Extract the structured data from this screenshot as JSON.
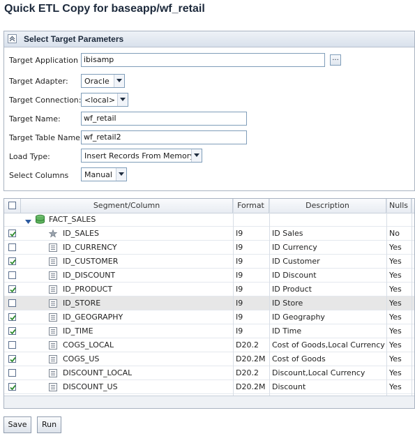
{
  "page": {
    "title": "Quick ETL Copy for baseapp/wf_retail"
  },
  "target_panel": {
    "title": "Select Target Parameters",
    "fields": {
      "target_application": {
        "label": "Target Application",
        "value": "ibisamp",
        "browse_label": "..."
      },
      "target_adapter": {
        "label": "Target Adapter:",
        "value": "Oracle"
      },
      "target_connection": {
        "label": "Target Connection:",
        "value": "<local>"
      },
      "target_name": {
        "label": "Target Name:",
        "value": "wf_retail"
      },
      "target_table_name": {
        "label": "Target Table Name:",
        "value": "wf_retail2"
      },
      "load_type": {
        "label": "Load Type:",
        "value": "Insert Records From Memory"
      },
      "select_columns": {
        "label": "Select Columns",
        "value": "Manual"
      }
    }
  },
  "grid": {
    "headers": {
      "segment_column": "Segment/Column",
      "format": "Format",
      "description": "Description",
      "nulls": "Nulls"
    },
    "segment": {
      "name": "FACT_SALES",
      "expanded": true
    },
    "rows": [
      {
        "name": "ID_SALES",
        "format": "I9",
        "description": "ID Sales",
        "nulls": "No",
        "checked": true,
        "icon": "key-column-icon"
      },
      {
        "name": "ID_CURRENCY",
        "format": "I9",
        "description": "ID Currency",
        "nulls": "Yes",
        "checked": false,
        "icon": "column-icon"
      },
      {
        "name": "ID_CUSTOMER",
        "format": "I9",
        "description": "ID Customer",
        "nulls": "Yes",
        "checked": true,
        "icon": "column-icon"
      },
      {
        "name": "ID_DISCOUNT",
        "format": "I9",
        "description": "ID Discount",
        "nulls": "Yes",
        "checked": false,
        "icon": "column-icon"
      },
      {
        "name": "ID_PRODUCT",
        "format": "I9",
        "description": "ID Product",
        "nulls": "Yes",
        "checked": true,
        "icon": "column-icon"
      },
      {
        "name": "ID_STORE",
        "format": "I9",
        "description": "ID Store",
        "nulls": "Yes",
        "checked": false,
        "icon": "column-icon",
        "highlighted": true
      },
      {
        "name": "ID_GEOGRAPHY",
        "format": "I9",
        "description": "ID Geography",
        "nulls": "Yes",
        "checked": true,
        "icon": "column-icon"
      },
      {
        "name": "ID_TIME",
        "format": "I9",
        "description": "ID Time",
        "nulls": "Yes",
        "checked": true,
        "icon": "column-icon"
      },
      {
        "name": "COGS_LOCAL",
        "format": "D20.2",
        "description": "Cost of Goods,Local Currency",
        "nulls": "Yes",
        "checked": false,
        "icon": "column-icon"
      },
      {
        "name": "COGS_US",
        "format": "D20.2M",
        "description": "Cost of Goods",
        "nulls": "Yes",
        "checked": true,
        "icon": "column-icon"
      },
      {
        "name": "DISCOUNT_LOCAL",
        "format": "D20.2",
        "description": "Discount,Local Currency",
        "nulls": "Yes",
        "checked": false,
        "icon": "column-icon"
      },
      {
        "name": "DISCOUNT_US",
        "format": "D20.2M",
        "description": "Discount",
        "nulls": "Yes",
        "checked": true,
        "icon": "column-icon"
      }
    ]
  },
  "buttons": {
    "save": "Save",
    "run": "Run"
  },
  "colors": {
    "check": "#2e8b2e",
    "row_highlight": "#e7e7e7",
    "panel_border": "#a9b3c1"
  }
}
